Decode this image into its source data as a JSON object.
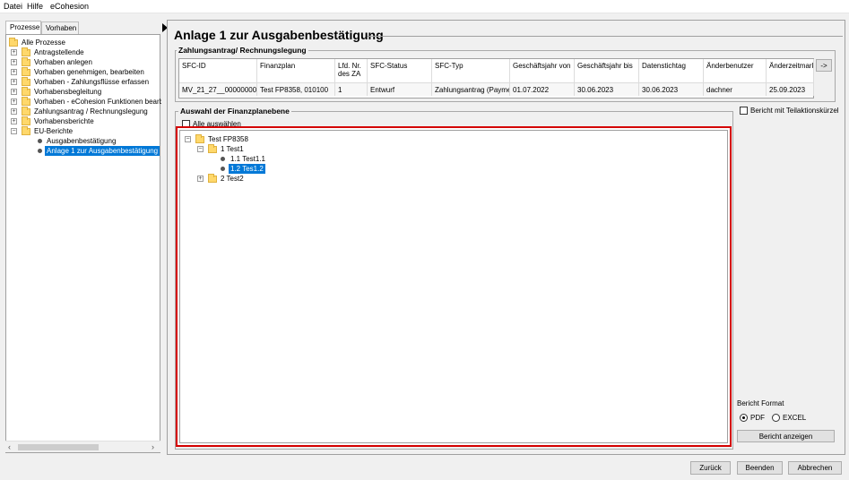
{
  "menu": [
    "Datei",
    "Hilfe",
    "eCohesion"
  ],
  "left_tabs": [
    {
      "label": "Prozesse",
      "active": true
    },
    {
      "label": "Vorhaben",
      "active": false
    }
  ],
  "nav_tree": [
    {
      "label": "Alle Prozesse"
    },
    {
      "label": "Antragstellende"
    },
    {
      "label": "Vorhaben anlegen"
    },
    {
      "label": "Vorhaben genehmigen, bearbeiten"
    },
    {
      "label": "Vorhaben - Zahlungsflüsse erfassen"
    },
    {
      "label": "Vorhabensbegleitung"
    },
    {
      "label": "Vorhaben - eCohesion Funktionen bearbeiten"
    },
    {
      "label": "Zahlungsantrag / Rechnungslegung"
    },
    {
      "label": "Vorhabensberichte"
    },
    {
      "label": "EU-Berichte"
    },
    {
      "label": "Ausgabenbestätigung"
    },
    {
      "label": "Anlage 1 zur Ausgabenbestätigung",
      "selected": true
    }
  ],
  "page_title": "Anlage 1 zur Ausgabenbestätigung",
  "payment_section": {
    "label": "Zahlungsantrag/ Rechnungslegung",
    "columns": [
      "SFC-ID",
      "Finanzplan",
      "Lfd. Nr. des ZA",
      "SFC-Status",
      "SFC-Typ",
      "Geschäftsjahr von",
      "Geschäftsjahr bis",
      "Datenstichtag",
      "Änderbenutzer",
      "Änderzeitmark"
    ],
    "row": [
      "MV_21_27__0000000007",
      "Test FP8358, 010100",
      "1",
      "Entwurf",
      "Zahlungsantrag (Paymen",
      "01.07.2022",
      "30.06.2023",
      "30.06.2023",
      "dachner",
      "25.09.2023"
    ],
    "more_button": "->"
  },
  "finance_section": {
    "label": "Auswahl der Finanzplanebene",
    "select_all": "Alle auswählen",
    "tree": [
      {
        "label": "Test FP8358"
      },
      {
        "label": "1 Test1"
      },
      {
        "label": "1.1 Test1.1"
      },
      {
        "label": "1.2 Tes1.2",
        "selected": true
      },
      {
        "label": "2 Test2"
      }
    ]
  },
  "options": {
    "teilaktion": "Bericht mit Teilaktionskürzel",
    "format_label": "Bericht Format",
    "format_pdf": "PDF",
    "format_excel": "EXCEL",
    "selected_format": "PDF",
    "show_report": "Bericht anzeigen"
  },
  "footer": {
    "back": "Zurück",
    "finish": "Beenden",
    "cancel": "Abbrechen"
  }
}
